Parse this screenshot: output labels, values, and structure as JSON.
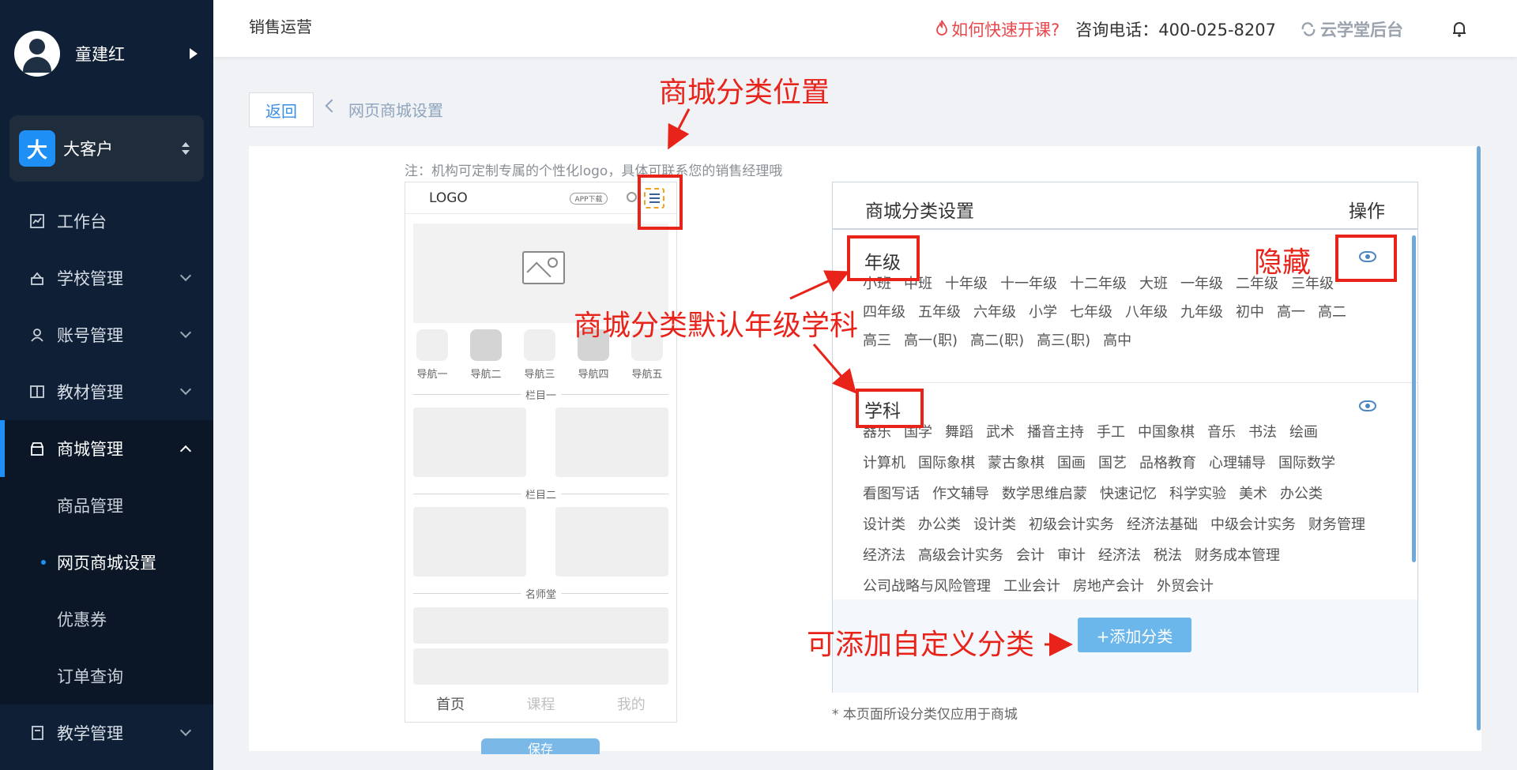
{
  "sidebar": {
    "user_name": "童建红",
    "client_badge": "大",
    "client_name": "大客户",
    "items": [
      {
        "label": "工作台"
      },
      {
        "label": "学校管理"
      },
      {
        "label": "账号管理"
      },
      {
        "label": "教材管理"
      },
      {
        "label": "商城管理"
      },
      {
        "label": "教学管理"
      }
    ],
    "sub_items": [
      {
        "label": "商品管理"
      },
      {
        "label": "网页商城设置"
      },
      {
        "label": "优惠券"
      },
      {
        "label": "订单查询"
      }
    ]
  },
  "topbar": {
    "title": "销售运营",
    "quick_start": "如何快速开课?",
    "phone": "咨询电话：400-025-8207",
    "backend": "云学堂后台"
  },
  "breadcrumb": {
    "back": "返回",
    "current": "网页商城设置"
  },
  "note": "注：机构可定制专属的个性化logo，具体可联系您的销售经理哦",
  "phone_mock": {
    "logo": "LOGO",
    "app_download": "APP下载",
    "nav": [
      "导航一",
      "导航二",
      "导航三",
      "导航四",
      "导航五"
    ],
    "section1": "栏目一",
    "section2": "栏目二",
    "section3": "名师堂",
    "tabs": [
      "首页",
      "课程",
      "我的"
    ],
    "save": "保存"
  },
  "category_table": {
    "header": "商城分类设置",
    "action_header": "操作",
    "grade": {
      "title": "年级",
      "tags": [
        "小班",
        "中班",
        "十年级",
        "十一年级",
        "十二年级",
        "大班",
        "一年级",
        "二年级",
        "三年级",
        "四年级",
        "五年级",
        "六年级",
        "小学",
        "七年级",
        "八年级",
        "九年级",
        "初中",
        "高一",
        "高二",
        "高三",
        "高一(职)",
        "高二(职)",
        "高三(职)",
        "高中"
      ]
    },
    "subject": {
      "title": "学科",
      "tags": [
        "器乐",
        "国学",
        "舞蹈",
        "武术",
        "播音主持",
        "手工",
        "中国象棋",
        "音乐",
        "书法",
        "绘画",
        "计算机",
        "国际象棋",
        "蒙古象棋",
        "国画",
        "国艺",
        "品格教育",
        "心理辅导",
        "国际数学",
        "看图写话",
        "作文辅导",
        "数学思维启蒙",
        "快速记忆",
        "科学实验",
        "美术",
        "办公类",
        "设计类",
        "办公类",
        "设计类",
        "初级会计实务",
        "经济法基础",
        "中级会计实务",
        "财务管理",
        "经济法",
        "高级会计实务",
        "会计",
        "审计",
        "经济法",
        "税法",
        "财务成本管理",
        "公司战略与风险管理",
        "工业会计",
        "房地产会计",
        "外贸会计"
      ]
    },
    "add_button": "+添加分类",
    "footnote": "* 本页面所设分类仅应用于商城"
  },
  "annotations": {
    "position": "商城分类位置",
    "default": "商城分类默认年级学科",
    "hide": "隐藏",
    "custom": "可添加自定义分类"
  },
  "colors": {
    "sidebar_bg": "#0f1f35",
    "accent": "#1e90f5",
    "annotation_red": "#e8231a",
    "quick_link": "#e8484b"
  }
}
